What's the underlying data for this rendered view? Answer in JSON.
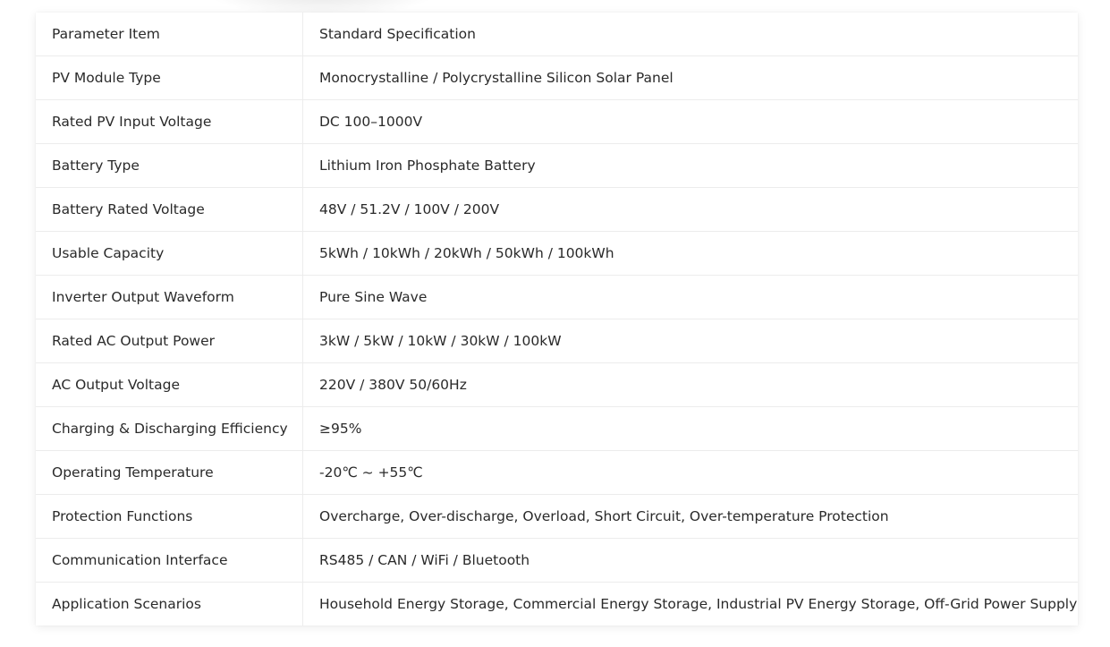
{
  "table": {
    "header": {
      "param": "Parameter Item",
      "spec": "Standard Specification"
    },
    "rows": [
      {
        "param": "PV Module Type",
        "spec": "Monocrystalline / Polycrystalline Silicon Solar Panel"
      },
      {
        "param": "Rated PV Input Voltage",
        "spec": "DC 100–1000V"
      },
      {
        "param": "Battery Type",
        "spec": "Lithium Iron Phosphate Battery"
      },
      {
        "param": "Battery Rated Voltage",
        "spec": "48V / 51.2V / 100V / 200V"
      },
      {
        "param": "Usable Capacity",
        "spec": "5kWh / 10kWh / 20kWh / 50kWh / 100kWh"
      },
      {
        "param": "Inverter Output Waveform",
        "spec": "Pure Sine Wave"
      },
      {
        "param": "Rated AC Output Power",
        "spec": "3kW / 5kW / 10kW / 30kW / 100kW"
      },
      {
        "param": "AC Output Voltage",
        "spec": "220V / 380V 50/60Hz"
      },
      {
        "param": "Charging & Discharging Efficiency",
        "spec": "≥95%"
      },
      {
        "param": "Operating Temperature",
        "spec": "-20℃ ~ +55℃"
      },
      {
        "param": "Protection Functions",
        "spec": "Overcharge, Over-discharge, Overload, Short Circuit, Over-temperature Protection"
      },
      {
        "param": "Communication Interface",
        "spec": "RS485 / CAN / WiFi / Bluetooth"
      },
      {
        "param": "Application Scenarios",
        "spec": "Household Energy Storage, Commercial Energy Storage, Industrial PV Energy Storage, Off-Grid Power Supply"
      }
    ]
  }
}
